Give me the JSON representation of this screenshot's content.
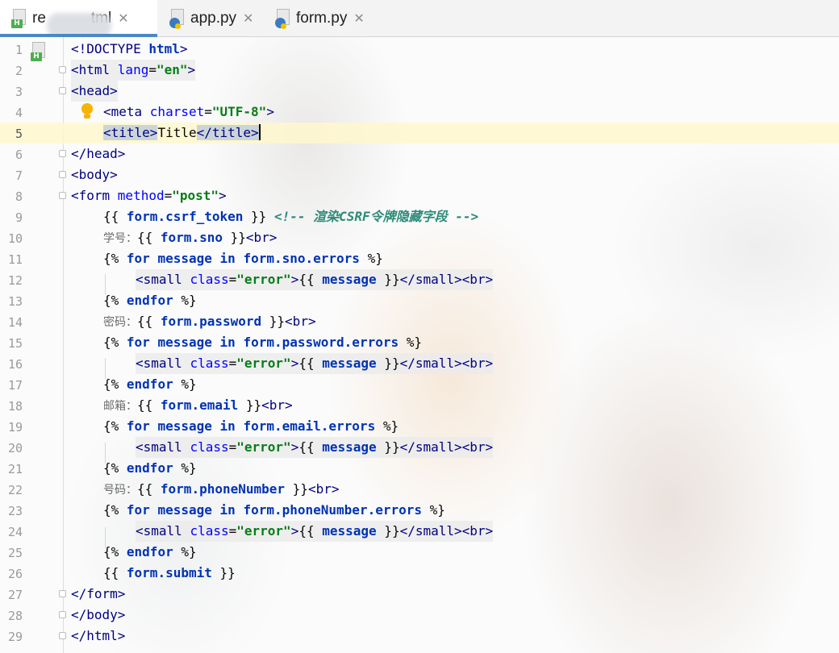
{
  "tabs": [
    {
      "label": "re",
      "label_tail": "tml",
      "icon": "html-file-icon",
      "active": true
    },
    {
      "label": "app.py",
      "icon": "python-file-icon",
      "active": false
    },
    {
      "label": "form.py",
      "icon": "python-file-icon",
      "active": false
    }
  ],
  "tab_close_glyph": "✕",
  "gutter": {
    "line_numbers": [
      "1",
      "2",
      "3",
      "4",
      "5",
      "6",
      "7",
      "8",
      "9",
      "10",
      "11",
      "12",
      "13",
      "14",
      "15",
      "16",
      "17",
      "18",
      "19",
      "20",
      "21",
      "22",
      "23",
      "24",
      "25",
      "26",
      "27",
      "28",
      "29"
    ],
    "current_line": "5"
  },
  "code": {
    "l1": {
      "a": "<!DOCTYPE ",
      "b": "html",
      "c": ">"
    },
    "l2": {
      "a": "<html ",
      "b": "lang",
      "c": "=",
      "d": "\"en\"",
      "e": ">"
    },
    "l3": {
      "a": "<head>"
    },
    "l4": {
      "a": "<meta ",
      "b": "charset",
      "c": "=",
      "d": "\"UTF-8\"",
      "e": ">"
    },
    "l5": {
      "a": "<title>",
      "b": "Title",
      "c": "</title>"
    },
    "l6": {
      "a": "</head>"
    },
    "l7": {
      "a": "<body>"
    },
    "l8": {
      "a": "<form ",
      "b": "method",
      "c": "=",
      "d": "\"post\"",
      "e": ">"
    },
    "l9": {
      "a": "{{ ",
      "b": "form.csrf_token",
      "c": " }} ",
      "d": "<!-- 渲染CSRF令牌隐藏字段 -->"
    },
    "l10": {
      "a": "学号：",
      "b": "{{ ",
      "c": "form.sno",
      "d": " }}",
      "e": "<br>"
    },
    "l11": {
      "a": "{% ",
      "b": "for",
      "c": " ",
      "d": "message",
      "e": " ",
      "f": "in",
      "g": " ",
      "h": "form.sno.errors",
      "i": " %}"
    },
    "l12": {
      "a": "<small ",
      "b": "class",
      "c": "=",
      "d": "\"error\"",
      "e": ">",
      "f": "{{ ",
      "g": "message",
      "h": " }}",
      "i": "</small><br>"
    },
    "l13": {
      "a": "{% ",
      "b": "endfor",
      "c": " %}"
    },
    "l14": {
      "a": "密码：",
      "b": "{{ ",
      "c": "form.password",
      "d": " }}",
      "e": "<br>"
    },
    "l15": {
      "a": "{% ",
      "b": "for",
      "c": " ",
      "d": "message",
      "e": " ",
      "f": "in",
      "g": " ",
      "h": "form.password.errors",
      "i": " %}"
    },
    "l16": {
      "a": "<small ",
      "b": "class",
      "c": "=",
      "d": "\"error\"",
      "e": ">",
      "f": "{{ ",
      "g": "message",
      "h": " }}",
      "i": "</small><br>"
    },
    "l17": {
      "a": "{% ",
      "b": "endfor",
      "c": " %}"
    },
    "l18": {
      "a": "邮箱：",
      "b": "{{ ",
      "c": "form.email",
      "d": " }}",
      "e": "<br>"
    },
    "l19": {
      "a": "{% ",
      "b": "for",
      "c": " ",
      "d": "message",
      "e": " ",
      "f": "in",
      "g": " ",
      "h": "form.email.errors",
      "i": " %}"
    },
    "l20": {
      "a": "<small ",
      "b": "class",
      "c": "=",
      "d": "\"error\"",
      "e": ">",
      "f": "{{ ",
      "g": "message",
      "h": " }}",
      "i": "</small><br>"
    },
    "l21": {
      "a": "{% ",
      "b": "endfor",
      "c": " %}"
    },
    "l22": {
      "a": "号码：",
      "b": "{{ ",
      "c": "form.phoneNumber",
      "d": " }}",
      "e": "<br>"
    },
    "l23": {
      "a": "{% ",
      "b": "for",
      "c": " ",
      "d": "message",
      "e": " ",
      "f": "in",
      "g": " ",
      "h": "form.phoneNumber.errors",
      "i": " %}"
    },
    "l24": {
      "a": "<small ",
      "b": "class",
      "c": "=",
      "d": "\"error\"",
      "e": ">",
      "f": "{{ ",
      "g": "message",
      "h": " }}",
      "i": "</small><br>"
    },
    "l25": {
      "a": "{% ",
      "b": "endfor",
      "c": " %}"
    },
    "l26": {
      "a": "{{ ",
      "b": "form.submit",
      "c": " }}"
    },
    "l27": {
      "a": "</form>"
    },
    "l28": {
      "a": "</body>"
    },
    "l29": {
      "a": "</html>"
    }
  },
  "colors": {
    "tag": "#000080",
    "attribute": "#0000ff",
    "attr_value": "#067d17",
    "keyword": "#0033b3",
    "comment": "#2e8b7a",
    "current_line": "#fff7cd",
    "tab_underline": "#4a88c7"
  }
}
